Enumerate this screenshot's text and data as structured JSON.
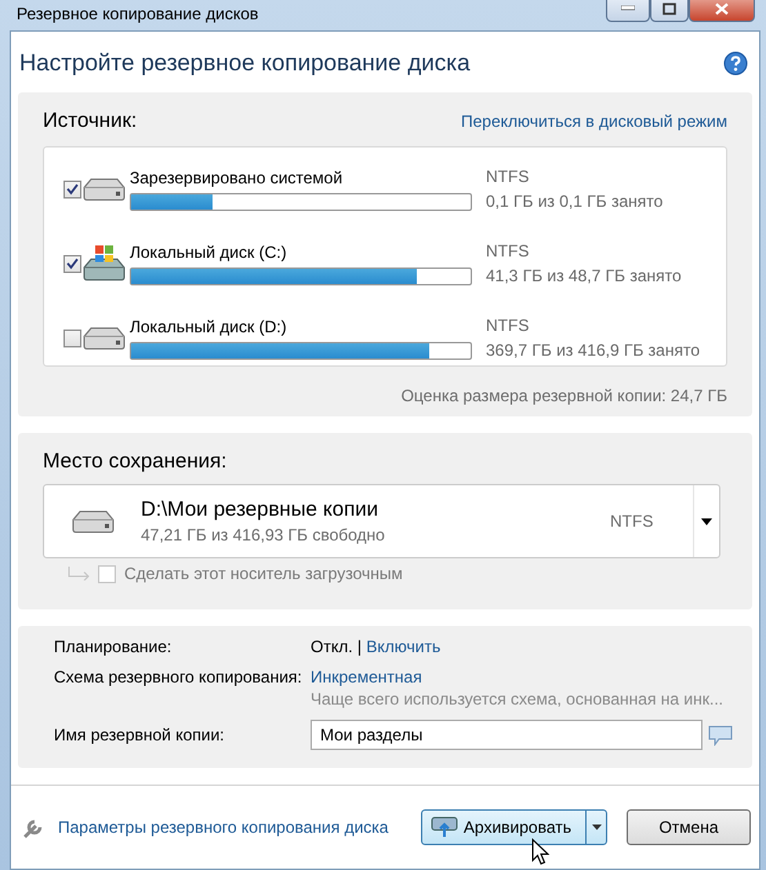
{
  "window": {
    "title": "Резервное копирование дисков"
  },
  "heading": "Настройте резервное копирование диска",
  "source": {
    "label": "Источник:",
    "switch_link": "Переключиться в дисковый режим",
    "partitions": [
      {
        "kind": "drive",
        "name": "Зарезервировано системой",
        "checked": true,
        "level": 0.24,
        "filesystem": "NTFS",
        "usage": "0,1 ГБ из 0,1 ГБ занято"
      },
      {
        "kind": "system_drive",
        "name": "Локальный диск (C:)",
        "checked": true,
        "level": 0.84,
        "filesystem": "NTFS",
        "usage": "41,3 ГБ из 48,7 ГБ занято"
      },
      {
        "kind": "drive",
        "name": "Локальный диск (D:)",
        "checked": false,
        "level": 0.88,
        "filesystem": "NTFS",
        "usage": "369,7 ГБ из 416,9 ГБ занято"
      }
    ],
    "estimate": "Оценка размера резервной копии: 24,7 ГБ"
  },
  "destination": {
    "label": "Место сохранения:",
    "path": "D:\\Мои резервные копии",
    "free": "47,21 ГБ из 416,93 ГБ свободно",
    "filesystem": "NTFS",
    "bootable": {
      "label": "Сделать этот носитель загрузочным",
      "checked": false,
      "disabled": true
    }
  },
  "settings": {
    "schedule_label": "Планирование:",
    "schedule_value": "Откл.",
    "schedule_separator": "|",
    "schedule_link": "Включить",
    "scheme_label": "Схема резервного копирования:",
    "scheme_link": "Инкрементная",
    "scheme_description": "Чаще всего используется схема, основанная на инк...",
    "name_label": "Имя резервной копии:",
    "name_value": "Мои разделы"
  },
  "footer": {
    "options_link": "Параметры резервного копирования диска",
    "backup_button": "Архивировать",
    "cancel_button": "Отмена"
  }
}
